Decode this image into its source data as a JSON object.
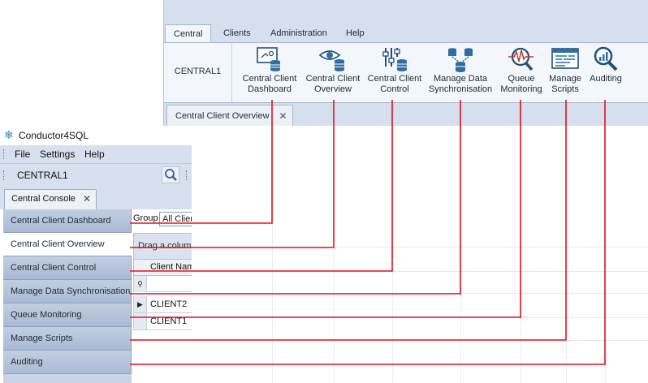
{
  "ribbon": {
    "tabs": [
      "Central",
      "Clients",
      "Administration",
      "Help"
    ],
    "group_label": "CENTRAL1",
    "buttons": [
      {
        "line1": "Central Client",
        "line2": "Dashboard",
        "icon": "dashboard-db-icon"
      },
      {
        "line1": "Central Client",
        "line2": "Overview",
        "icon": "eye-db-icon"
      },
      {
        "line1": "Central Client",
        "line2": "Control",
        "icon": "sliders-db-icon"
      },
      {
        "line1": "Manage Data",
        "line2": "Synchronisation",
        "icon": "sync-db-icon"
      },
      {
        "line1": "Queue",
        "line2": "Monitoring",
        "icon": "pulse-magnifier-icon"
      },
      {
        "line1": "Manage",
        "line2": "Scripts",
        "icon": "script-window-icon"
      },
      {
        "line1": "Auditing",
        "line2": "",
        "icon": "audit-magnifier-icon"
      }
    ],
    "doc_tab": "Central Client Overview"
  },
  "old_client": {
    "title": "Conductor4SQL",
    "menu": [
      "File",
      "Settings",
      "Help"
    ],
    "toolbar_name": "CENTRAL1",
    "doc_tab": "Central Console",
    "nav_items": [
      "Central Client Dashboard",
      "Central Client Overview",
      "Central Client Control",
      "Manage Data Synchronisation",
      "Queue Monitoring",
      "Manage Scripts",
      "Auditing"
    ],
    "selected_nav_index": 1,
    "group_label": "Group",
    "group_value": "All Clien",
    "drag_hint": "Drag a column",
    "column_header": "Client Nam",
    "rows": [
      "CLIENT2",
      "CLIENT1"
    ]
  },
  "colors": {
    "callout_line": "#e8101c",
    "ribbon_bg": "#d5dfed",
    "nav_bg": "#b4c3da"
  }
}
